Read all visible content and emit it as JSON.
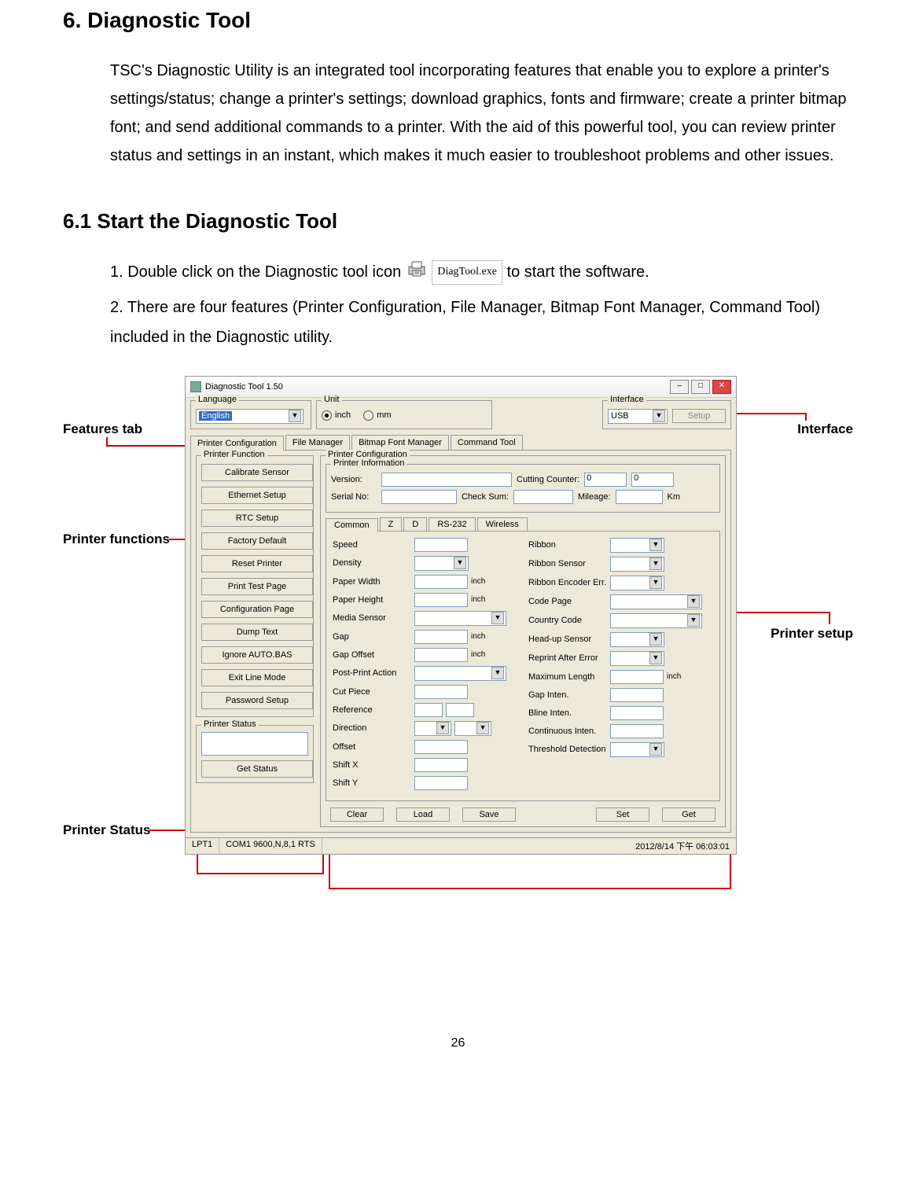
{
  "heading": "6. Diagnostic Tool",
  "intro": "TSC's Diagnostic Utility is an integrated tool incorporating features that enable you to explore a printer's settings/status; change a printer's settings; download graphics, fonts and firmware; create a printer bitmap font; and send additional commands to a printer. With the aid of this powerful tool, you can review printer status and settings in an instant, which makes it much easier to troubleshoot problems and other issues.",
  "subheading": "6.1 Start the Diagnostic Tool",
  "step1_a": "1. Double click on the Diagnostic tool icon",
  "exe_name": "DiagTool.exe",
  "step1_b": "to start the software.",
  "step2": "2. There are four features (Printer Configuration, File Manager, Bitmap Font Manager, Command Tool) included in the Diagnostic utility.",
  "callouts": {
    "features_tab": "Features tab",
    "printer_functions": "Printer functions",
    "printer_status": "Printer Status",
    "interface": "Interface",
    "printer_setup": "Printer setup"
  },
  "app": {
    "title": "Diagnostic Tool 1.50",
    "language_label": "Language",
    "language_value": "English",
    "unit_label": "Unit",
    "unit_inch": "inch",
    "unit_mm": "mm",
    "interface_label": "Interface",
    "interface_value": "USB",
    "setup_btn": "Setup",
    "tabs": [
      "Printer Configuration",
      "File Manager",
      "Bitmap Font Manager",
      "Command Tool"
    ],
    "func_group": "Printer Function",
    "func_buttons": [
      "Calibrate Sensor",
      "Ethernet Setup",
      "RTC Setup",
      "Factory Default",
      "Reset Printer",
      "Print Test Page",
      "Configuration Page",
      "Dump Text",
      "Ignore AUTO.BAS",
      "Exit Line Mode",
      "Password Setup"
    ],
    "status_group": "Printer Status",
    "get_status_btn": "Get Status",
    "cfg_group": "Printer Configuration",
    "info_group": "Printer Information",
    "info": {
      "version_lbl": "Version:",
      "serial_lbl": "Serial No:",
      "checksum_lbl": "Check Sum:",
      "cutting_lbl": "Cutting Counter:",
      "cutting_val": "0",
      "cutting_val2": "0",
      "mileage_lbl": "Mileage:",
      "mileage_unit": "Km"
    },
    "subtabs": [
      "Common",
      "Z",
      "D",
      "RS-232",
      "Wireless"
    ],
    "fields_left": [
      {
        "label": "Speed",
        "type": "txt"
      },
      {
        "label": "Density",
        "type": "combo"
      },
      {
        "label": "Paper Width",
        "type": "txt",
        "unit": "inch"
      },
      {
        "label": "Paper Height",
        "type": "txt",
        "unit": "inch"
      },
      {
        "label": "Media Sensor",
        "type": "combo_wide"
      },
      {
        "label": "Gap",
        "type": "txt",
        "unit": "inch"
      },
      {
        "label": "Gap Offset",
        "type": "txt",
        "unit": "inch"
      },
      {
        "label": "Post-Print Action",
        "type": "combo_wide"
      },
      {
        "label": "Cut Piece",
        "type": "txt"
      },
      {
        "label": "Reference",
        "type": "txt2"
      },
      {
        "label": "Direction",
        "type": "combo2"
      },
      {
        "label": "Offset",
        "type": "txt"
      },
      {
        "label": "Shift X",
        "type": "txt"
      },
      {
        "label": "Shift Y",
        "type": "txt"
      }
    ],
    "fields_right": [
      {
        "label": "Ribbon",
        "type": "combo"
      },
      {
        "label": "Ribbon Sensor",
        "type": "combo"
      },
      {
        "label": "Ribbon Encoder Err.",
        "type": "combo"
      },
      {
        "label": "Code Page",
        "type": "combo_wide"
      },
      {
        "label": "Country Code",
        "type": "combo_wide"
      },
      {
        "label": "Head-up Sensor",
        "type": "combo"
      },
      {
        "label": "Reprint After Error",
        "type": "combo"
      },
      {
        "label": "Maximum Length",
        "type": "txt",
        "unit": "inch"
      },
      {
        "label": "Gap Inten.",
        "type": "txt"
      },
      {
        "label": "Bline Inten.",
        "type": "txt"
      },
      {
        "label": "Continuous Inten.",
        "type": "txt"
      },
      {
        "label": "Threshold Detection",
        "type": "combo"
      }
    ],
    "bottom_btns": [
      "Clear",
      "Load",
      "Save",
      "Set",
      "Get"
    ],
    "statusbar": {
      "port": "LPT1",
      "com": "COM1 9600,N,8,1 RTS",
      "time": "2012/8/14 下午 06:03:01"
    }
  },
  "page_number": "26"
}
